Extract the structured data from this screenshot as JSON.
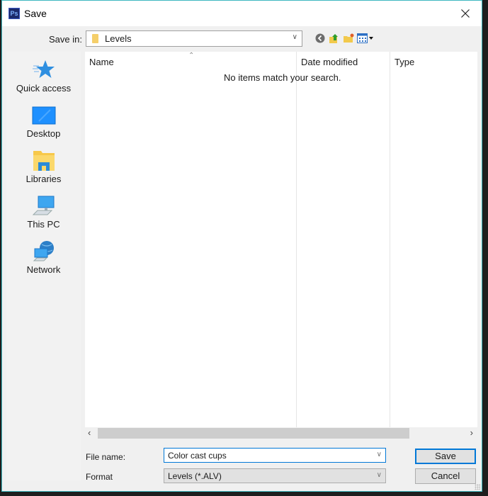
{
  "window": {
    "title": "Save",
    "app_icon": "photoshop-icon",
    "app_icon_text": "Ps",
    "close_icon": "close-icon"
  },
  "toolbar": {
    "save_in_label": "Save in:",
    "save_in_value": "Levels",
    "icons": [
      "back-icon",
      "up-folder-icon",
      "new-folder-icon",
      "view-menu-icon"
    ]
  },
  "sidebar": {
    "items": [
      {
        "label": "Quick access",
        "icon": "star-icon"
      },
      {
        "label": "Desktop",
        "icon": "desktop-icon"
      },
      {
        "label": "Libraries",
        "icon": "libraries-icon"
      },
      {
        "label": "This PC",
        "icon": "computer-icon"
      },
      {
        "label": "Network",
        "icon": "network-icon"
      }
    ]
  },
  "filelist": {
    "columns": [
      "Name",
      "Date modified",
      "Type"
    ],
    "sort_column": "Name",
    "empty_message": "No items match your search."
  },
  "form": {
    "file_name_label": "File name:",
    "file_name_value": "Color cast cups",
    "format_label": "Format",
    "format_value": "Levels (*.ALV)",
    "save_label": "Save",
    "cancel_label": "Cancel"
  },
  "colors": {
    "accent": "#0078d7",
    "dialog_border": "#3fb8c0",
    "dialog_bg": "#f0f0f0"
  }
}
